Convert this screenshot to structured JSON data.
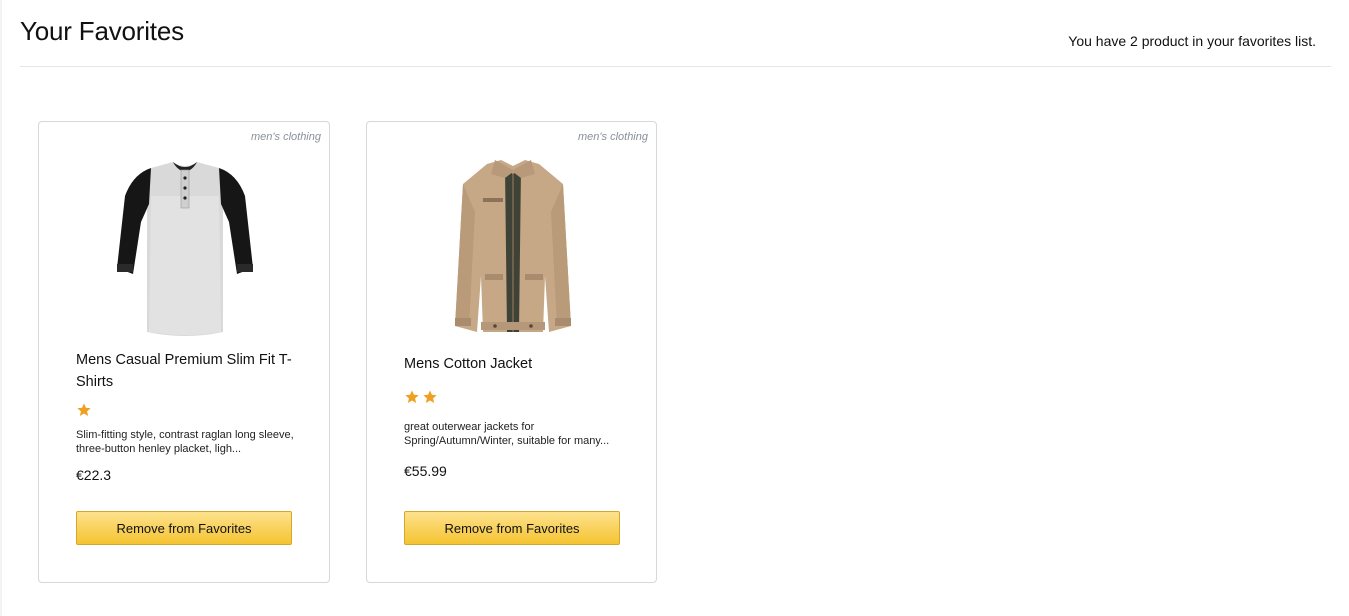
{
  "header": {
    "title": "Your Favorites",
    "count_text": "You have 2 product in your favorites list."
  },
  "products": [
    {
      "category": "men's clothing",
      "title": "Mens Casual Premium Slim Fit T-Shirts",
      "rating_stars": 1,
      "description": "Slim-fitting style, contrast raglan long sleeve, three-button henley placket, ligh...",
      "price": "€22.3",
      "button_label": "Remove from Favorites",
      "image": "raglan-henley-shirt-image"
    },
    {
      "category": "men's clothing",
      "title": "Mens Cotton Jacket",
      "rating_stars": 2,
      "description": "great outerwear jackets for Spring/Autumn/Winter, suitable for many...",
      "price": "€55.99",
      "button_label": "Remove from Favorites",
      "image": "khaki-cotton-jacket-image"
    }
  ],
  "colors": {
    "star": "#f0a020",
    "button_top": "#fde18d",
    "button_bottom": "#f5c431",
    "card_border": "#d5d9d9",
    "category_text": "#8a8f98"
  }
}
